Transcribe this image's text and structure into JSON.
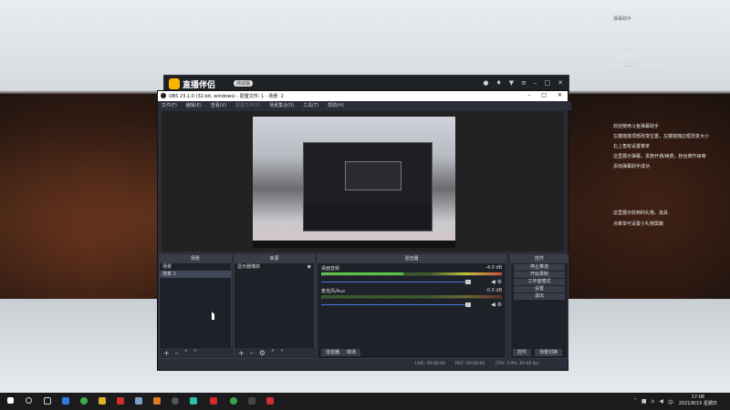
{
  "overlay": {
    "top_label": "弹幕助手",
    "msg1": "这里展示欢迎进场信息",
    "msg2_prefix": "欢迎",
    "msg2_suffix": "进入直播间",
    "desc": [
      "欢迎使用斗鱼弹幕助手",
      "左键拖拽顶部改变位置，左键拖拽边框改变大小",
      "右上角有设置菜单",
      "这里展示弹幕，贵族开通/续费，粉丝牌升级等",
      "添加弹幕助手成功"
    ],
    "gift": [
      "这里展示收到的礼物、道具",
      "点菜单可设置小礼物屏蔽"
    ]
  },
  "zhibo": {
    "title": "直播伴侣",
    "badge": "测试版"
  },
  "obs": {
    "title": "OBS 23.1.0 (32-bit, windows) - 配置文件: 1 - 场景: 2",
    "menu": [
      "文件(F)",
      "编辑(E)",
      "查看(V)",
      "配置文件(P)",
      "场景集合(S)",
      "工具(T)",
      "帮助(H)"
    ],
    "scenes": {
      "header": "场景",
      "items": [
        "场景",
        "场景 2"
      ],
      "selected": 1
    },
    "sources": {
      "header": "来源",
      "items": [
        "显示器捕获"
      ]
    },
    "mixer": {
      "header": "混音器",
      "tracks": [
        {
          "name": "桌面音频",
          "db": "-4.0 dB",
          "level": 0.45
        },
        {
          "name": "麦克风/Aux",
          "db": "-0.0 dB",
          "level": 0
        }
      ],
      "tabs": [
        "混音器",
        "转场"
      ]
    },
    "controls": {
      "header": "控件",
      "buttons": [
        "停止推流",
        "开始录制",
        "工作室模式",
        "设置",
        "退出"
      ]
    },
    "bottom_tabs": [
      "控件",
      "场景切换"
    ],
    "status": {
      "live": "LIVE: 00:00:00",
      "rec": "REC: 00:00:00",
      "cpu": "CPU: 3.9%, 60.00 fps"
    }
  },
  "taskbar": {
    "time": "17:06",
    "date": "2021/8/15 星期日"
  },
  "colors": {
    "accent": "#ffb400",
    "obs_bg": "#2b2e38",
    "meter_green": "#5fc24b"
  }
}
